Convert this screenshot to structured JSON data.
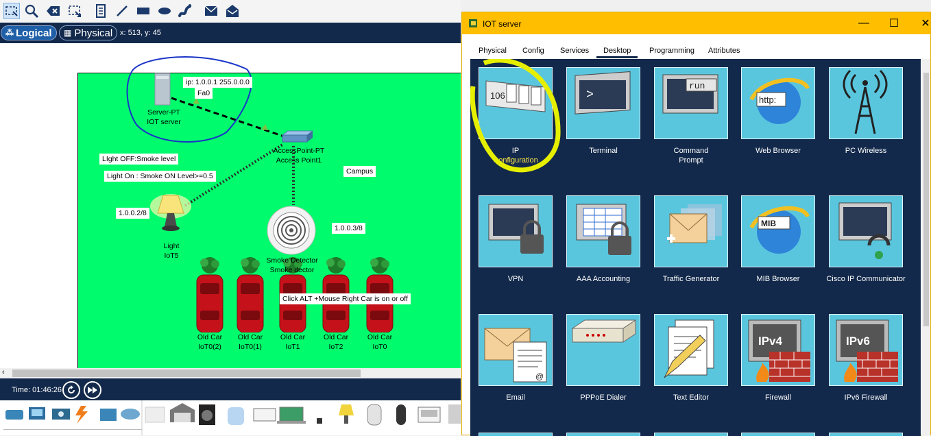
{
  "toolbar": {
    "icons": [
      "select-icon",
      "inspect-icon",
      "delete-icon",
      "resize-icon",
      "note-icon",
      "line-icon",
      "rectangle-icon",
      "ellipse-icon",
      "freeform-icon",
      "simple-pdu-icon",
      "complex-pdu-icon"
    ]
  },
  "modebar": {
    "logical_label": "Logical",
    "physical_label": "Physical",
    "coords": "x: 513, y: 45"
  },
  "workspace": {
    "server_ip_label": "ip: 1.0.0.1 255.0.0.0",
    "server_port_label": "Fa0",
    "server_name_1": "Server-PT",
    "server_name_2": "IOT server",
    "ap_name_1": "AccessPoint-PT",
    "ap_name_2": "Access Point1",
    "campus_label": "Campus",
    "light_off_note": "LIght OFF:Smoke level",
    "light_on_note": "Light On : Smoke ON Level>=0.5",
    "light_ip": "1.0.0.2/8",
    "light_name_1": "Light",
    "light_name_2": "IoT5",
    "smoke_ip": "1.0.0.3/8",
    "smoke_name_1": "Smoke Detector",
    "smoke_name_2": "Smoke dector",
    "car_note": "Click ALT +Mouse Right Car is on or off",
    "cars": [
      {
        "line1": "Old Car",
        "line2": "IoT0(2)"
      },
      {
        "line1": "Old Car",
        "line2": "IoT0(1)"
      },
      {
        "line1": "Old Car",
        "line2": "IoT1"
      },
      {
        "line1": "Old Car",
        "line2": "IoT2"
      },
      {
        "line1": "Old Car",
        "line2": "IoT0"
      }
    ]
  },
  "timebar": {
    "time": "Time: 01:46:26"
  },
  "iot_window": {
    "title": "IOT server",
    "controls": {
      "minimize": "—",
      "maximize": "☐",
      "close": "✕"
    },
    "tabs": [
      "Physical",
      "Config",
      "Services",
      "Desktop",
      "Programming",
      "Attributes"
    ],
    "active_tab": "Desktop",
    "apps": [
      {
        "line1": "IP",
        "line2": "Configuration",
        "icon": "ip-config-icon"
      },
      {
        "line1": "Terminal",
        "line2": "",
        "icon": "terminal-icon"
      },
      {
        "line1": "Command",
        "line2": "Prompt",
        "icon": "command-prompt-icon"
      },
      {
        "line1": "Web Browser",
        "line2": "",
        "icon": "web-browser-icon"
      },
      {
        "line1": "PC Wireless",
        "line2": "",
        "icon": "wireless-icon"
      },
      {
        "line1": "VPN",
        "line2": "",
        "icon": "vpn-icon"
      },
      {
        "line1": "AAA Accounting",
        "line2": "",
        "icon": "aaa-icon"
      },
      {
        "line1": "Traffic Generator",
        "line2": "",
        "icon": "traffic-generator-icon"
      },
      {
        "line1": "MIB Browser",
        "line2": "",
        "icon": "mib-browser-icon"
      },
      {
        "line1": "Cisco IP Communicator",
        "line2": "",
        "icon": "ip-communicator-icon"
      },
      {
        "line1": "Email",
        "line2": "",
        "icon": "email-icon"
      },
      {
        "line1": "PPPoE Dialer",
        "line2": "",
        "icon": "pppoe-icon"
      },
      {
        "line1": "Text Editor",
        "line2": "",
        "icon": "text-editor-icon"
      },
      {
        "line1": "Firewall",
        "line2": "",
        "icon": "firewall-icon"
      },
      {
        "line1": "IPv6 Firewall",
        "line2": "",
        "icon": "ipv6-firewall-icon"
      }
    ],
    "icon_text": {
      "ip_number": "106",
      "terminal_prompt": ">",
      "cmd_run": "run",
      "http": "http:",
      "mib": "MIB",
      "ipv4": "IPv4",
      "ipv6": "IPv6"
    }
  }
}
